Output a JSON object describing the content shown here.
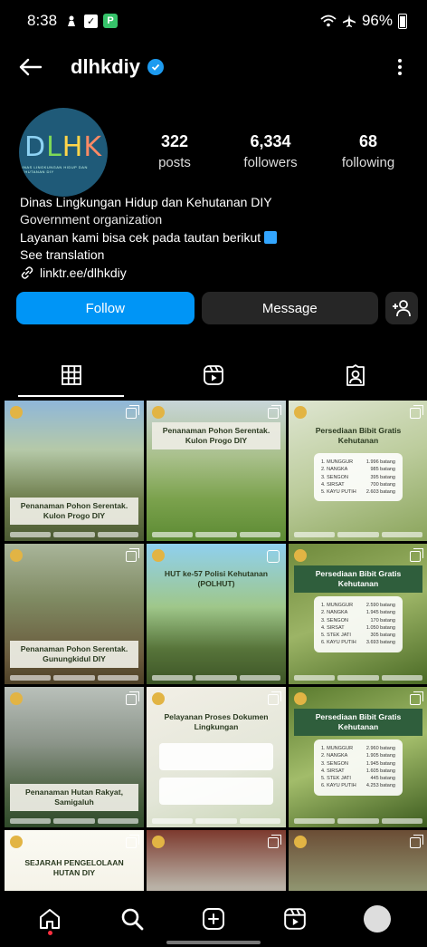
{
  "status_bar": {
    "time": "8:38",
    "battery": "96%",
    "icons": [
      "person-icon",
      "message-icon",
      "app-icon",
      "wifi-icon",
      "airplane-icon",
      "battery-icon"
    ]
  },
  "header": {
    "username": "dlhkdiy",
    "verified": true
  },
  "profile": {
    "avatar_text": "DLHK",
    "avatar_subtext": "DINAS LINGKUNGAN HIDUP DAN KEHUTANAN DIY",
    "stats": [
      {
        "value": "322",
        "label": "posts"
      },
      {
        "value": "6,334",
        "label": "followers"
      },
      {
        "value": "68",
        "label": "following"
      }
    ],
    "bio": {
      "name": "Dinas Lingkungan Hidup dan Kehutanan DIY",
      "category": "Government organization",
      "description": "Layanan kami bisa cek pada tautan berikut",
      "see_translation": "See translation",
      "link": "linktr.ee/dlhkdiy"
    }
  },
  "actions": {
    "follow": "Follow",
    "message": "Message"
  },
  "tabs": [
    "grid-icon",
    "reels-icon",
    "tagged-icon"
  ],
  "posts": [
    {
      "title": "Penanaman Pohon Serentak. Kulon Progo DIY",
      "style": "t-dark",
      "pos": "bottom",
      "bg": "linear-gradient(180deg,#8fb7d9 0%,#b5c9a8 35%,#6f7e4d 70%,#4b5a33 100%)"
    },
    {
      "title": "Penanaman Pohon Serentak. Kulon Progo DIY",
      "style": "t-dark",
      "pos": "top",
      "bg": "linear-gradient(180deg,#c8d5d9 0%,#a9c08b 40%,#7ba24d 70%,#5c8a33 100%)"
    },
    {
      "title": "Persediaan Bibit Gratis Kehutanan",
      "style": "t-plain",
      "pos": "top",
      "bg": "linear-gradient(160deg,#dfe6d2 0%,#bccc9c 50%,#8aa45b 100%)",
      "list": [
        [
          "1. MUNGGUR",
          "1.996 batang"
        ],
        [
          "2. NANGKA",
          "985 batang"
        ],
        [
          "3. SENGON",
          "395 batang"
        ],
        [
          "4. SIRSAT",
          "700 batang"
        ],
        [
          "5. KAYU PUTIH",
          "2.603 batang"
        ]
      ]
    },
    {
      "title": "Penanaman Pohon Serentak. Gunungkidul DIY",
      "style": "t-dark",
      "pos": "bottom",
      "bg": "linear-gradient(180deg,#a9b59a 0%,#7f8a62 40%,#6a5b3d 80%,#4d4027 100%)"
    },
    {
      "title": "HUT ke-57 Polisi Kehutanan (POLHUT)",
      "style": "t-plain",
      "pos": "top",
      "bg": "linear-gradient(180deg,#8fd0ef 0%,#9fc78a 45%,#57743a 75%,#3c5426 100%)"
    },
    {
      "title": "Persediaan Bibit Gratis Kehutanan",
      "style": "t-green",
      "pos": "top",
      "bg": "linear-gradient(160deg,#6f8a3c 0%,#9cb466 50%,#4a6a25 100%)",
      "list": [
        [
          "1. MUNGGUR",
          "2.590 batang"
        ],
        [
          "2. NANGKA",
          "1.945 batang"
        ],
        [
          "3. SENGON",
          "170 batang"
        ],
        [
          "4. SIRSAT",
          "1.050 batang"
        ],
        [
          "5. STEK JATI",
          "305 batang"
        ],
        [
          "6. KAYU PUTIH",
          "3.693 batang"
        ]
      ]
    },
    {
      "title": "Penanaman Hutan Rakyat, Samigaluh",
      "style": "t-dark",
      "pos": "bottom",
      "bg": "linear-gradient(180deg,#b9c0ba 0%,#8c958a 40%,#4d6242 75%,#2f4a2a 100%)"
    },
    {
      "title": "Pelayanan Proses Dokumen Lingkungan",
      "style": "t-plain",
      "pos": "top",
      "bg": "linear-gradient(160deg,#f2efe6 0%,#e3e6d8 60%,#c9d6b6 100%)"
    },
    {
      "title": "Persediaan Bibit Gratis Kehutanan",
      "style": "t-green",
      "pos": "top",
      "bg": "linear-gradient(160deg,#5a7a2e 0%,#a2bc6a 50%,#3d5c1f 100%)",
      "list": [
        [
          "1. MUNGGUR",
          "2.960 batang"
        ],
        [
          "2. NANGKA",
          "1.905 batang"
        ],
        [
          "3. SENGON",
          "1.945 batang"
        ],
        [
          "4. SIRSAT",
          "1.605 batang"
        ],
        [
          "5. STEK JATI",
          "445 batang"
        ],
        [
          "6. KAYU PUTIH",
          "4.253 batang"
        ]
      ]
    },
    {
      "title": "SEJARAH PENGELOLAAN HUTAN DIY",
      "style": "t-plain",
      "pos": "bottom",
      "bg": "linear-gradient(180deg,#fbfaf3 0%,#f2f0e4 60%,#2f5e3c 100%)"
    },
    {
      "title": "",
      "style": "t-plain",
      "pos": "top",
      "bg": "linear-gradient(180deg,#7d3a2e 0%,#b8b0a5 40%,#e6e1d6 100%)"
    },
    {
      "title": "",
      "style": "t-plain",
      "pos": "top",
      "bg": "linear-gradient(180deg,#6b4d35 0%,#96a17a 50%,#4f6238 100%)"
    }
  ],
  "bottom_nav": [
    "home-icon",
    "search-icon",
    "create-icon",
    "reels-icon",
    "profile-icon"
  ]
}
